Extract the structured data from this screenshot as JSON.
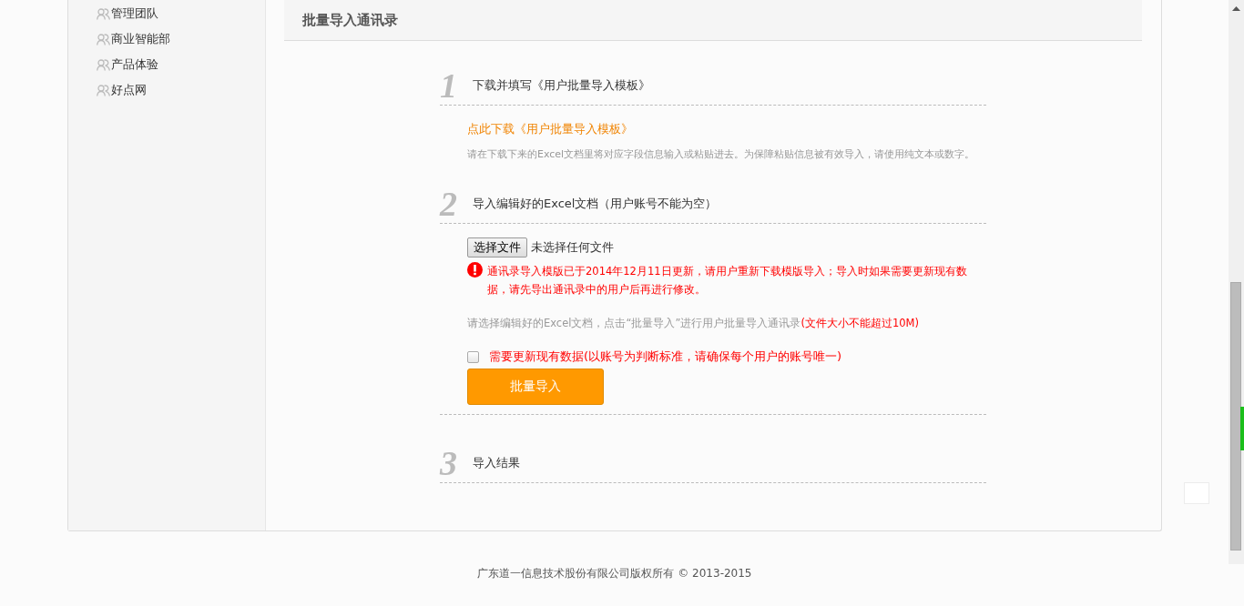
{
  "sidebar": {
    "items": [
      {
        "label": "管理团队"
      },
      {
        "label": "商业智能部"
      },
      {
        "label": "产品体验"
      },
      {
        "label": "好点网"
      }
    ]
  },
  "page_title": "批量导入通讯录",
  "steps": [
    {
      "number": "1",
      "title": "下载并填写《用户批量导入模板》",
      "link": "点此下载《用户批量导入模板》",
      "note": "请在下载下来的Excel文档里将对应字段信息输入或粘贴进去。为保障粘贴信息被有效导入，请使用纯文本或数字。"
    },
    {
      "number": "2",
      "title": "导入编辑好的Excel文档（用户账号不能为空）",
      "file_button": "选择文件",
      "file_status": "未选择任何文件",
      "warning": "通讯录导入模版已于2014年12月11日更新，请用户重新下载模版导入；导入时如果需要更新现有数据，请先导出通讯录中的用户后再进行修改。",
      "hint": "请选择编辑好的Excel文档，点击“批量导入”进行用户批量导入通讯录",
      "hint_limit": "(文件大小不能超过10M)",
      "checkbox": {
        "label": "需要更新现有数据(以账号为判断标准，请确保每个用户的账号唯一)",
        "checked": false
      },
      "submit": "批量导入"
    },
    {
      "number": "3",
      "title": "导入结果"
    }
  ],
  "footer": "广东道一信息技术股份有限公司版权所有 © 2013-2015"
}
